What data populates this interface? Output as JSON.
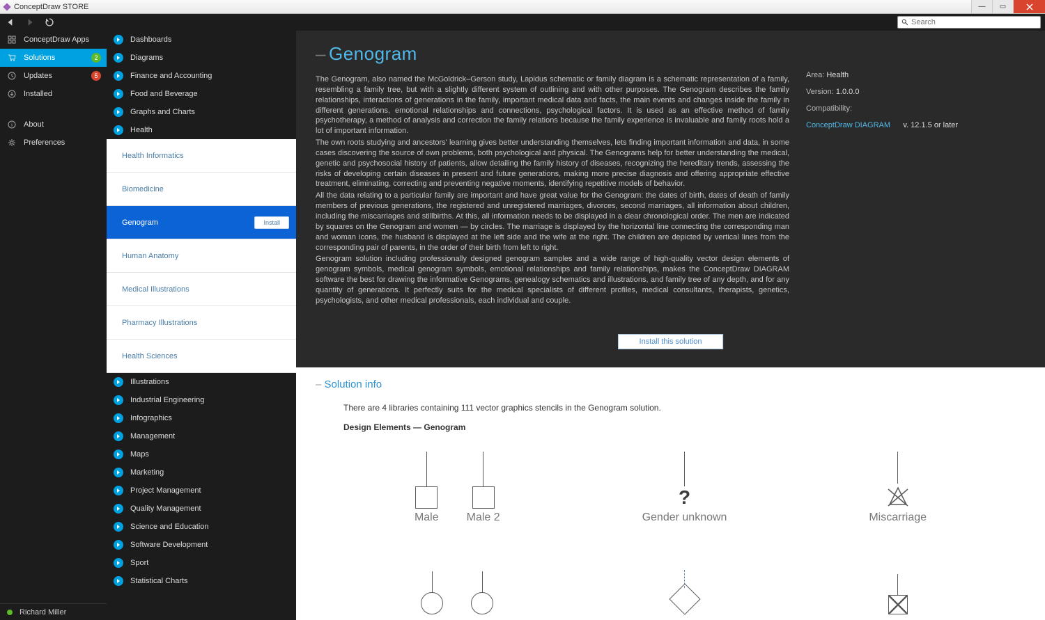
{
  "window": {
    "title": "ConceptDraw STORE"
  },
  "search": {
    "placeholder": "Search"
  },
  "sidebar": {
    "items": [
      {
        "label": "ConceptDraw Apps"
      },
      {
        "label": "Solutions",
        "badge": "2",
        "badgeColor": "green",
        "active": true
      },
      {
        "label": "Updates",
        "badge": "5",
        "badgeColor": "red"
      },
      {
        "label": "Installed"
      }
    ],
    "lower": [
      {
        "label": "About"
      },
      {
        "label": "Preferences"
      }
    ],
    "user": "Richard Miller"
  },
  "categories": [
    {
      "label": "Dashboards"
    },
    {
      "label": "Diagrams"
    },
    {
      "label": "Finance and Accounting"
    },
    {
      "label": "Food and Beverage"
    },
    {
      "label": "Graphs and Charts"
    },
    {
      "label": "Health",
      "expanded": true
    },
    {
      "label": "Illustrations"
    },
    {
      "label": "Industrial Engineering"
    },
    {
      "label": "Infographics"
    },
    {
      "label": "Management"
    },
    {
      "label": "Maps"
    },
    {
      "label": "Marketing"
    },
    {
      "label": "Project Management"
    },
    {
      "label": "Quality Management"
    },
    {
      "label": "Science and Education"
    },
    {
      "label": "Software Development"
    },
    {
      "label": "Sport"
    },
    {
      "label": "Statistical Charts"
    }
  ],
  "subitems": [
    {
      "label": "Health Informatics"
    },
    {
      "label": "Biomedicine"
    },
    {
      "label": "Genogram",
      "active": true,
      "installPill": "Install"
    },
    {
      "label": "Human Anatomy"
    },
    {
      "label": "Medical Illustrations"
    },
    {
      "label": "Pharmacy Illustrations"
    },
    {
      "label": "Health Sciences"
    }
  ],
  "hero": {
    "title": "Genogram",
    "p1": "The Genogram, also named the McGoldrick–Gerson study, Lapidus schematic or family diagram is a schematic representation of a family, resembling a family tree, but with a slightly different system of outlining and with other purposes. The Genogram describes the family relationships, interactions of generations in the family, important medical data and facts, the main events and changes inside the family in different generations, emotional relationships and connections, psychological factors. It is used as an effective method of family psychotherapy, a method of analysis and correction the family relations because the family experience is invaluable and family roots hold a lot of important information.",
    "p2": "The own roots studying and ancestors' learning gives better understanding themselves, lets finding important information and data, in some cases discovering the source of own problems, both psychological and physical. The Genograms help for better understanding the medical, genetic and psychosocial history of patients, allow detailing the family history of diseases, recognizing the hereditary trends, assessing the risks of developing certain diseases in present and future generations, making more precise diagnosis and offering appropriate effective treatment, eliminating, correcting and preventing negative moments, identifying repetitive models of behavior.",
    "p3": "All the data relating to a particular family are important and have great value for the Genogram: the dates of birth, dates of death of family members of previous generations, the registered and unregistered marriages, divorces, second marriages, all information about children, including the miscarriages and stillbirths. At this, all information needs to be displayed in a clear chronological order. The men are indicated by squares on the Genogram and women — by circles. The marriage is displayed by the horizontal line connecting the corresponding man and woman icons, the husband is displayed at the left side and the wife at the right. The children are depicted by vertical lines from the corresponding pair of parents, in the order of their birth from left to right.",
    "p4": "Genogram solution including professionally designed genogram samples and a wide range of high-quality vector design elements of genogram symbols, medical genogram symbols, emotional relationships and family relationships, makes the ConceptDraw DIAGRAM software the best for drawing the informative Genograms, genealogy schematics and illustrations, and family tree of any depth, and for any quantity of generations. It perfectly suits for the medical specialists of different profiles, medical consultants, therapists, genetics, psychologists, and other medical professionals, each individual and couple.",
    "installButton": "Install this solution",
    "meta": {
      "areaLabel": "Area:",
      "areaValue": "Health",
      "versionLabel": "Version:",
      "versionValue": "1.0.0.0",
      "compatLabel": "Compatibility:",
      "compatApp": "ConceptDraw DIAGRAM",
      "compatVer": "v. 12.1.5 or later"
    }
  },
  "info": {
    "title": "Solution info",
    "lead": "There are 4 libraries containing 111 vector graphics stencils in the Genogram solution.",
    "subhead": "Design Elements — Genogram",
    "stencils": {
      "male": "Male",
      "male2": "Male 2",
      "genderUnknown": "Gender unknown",
      "miscarriage": "Miscarriage"
    }
  }
}
